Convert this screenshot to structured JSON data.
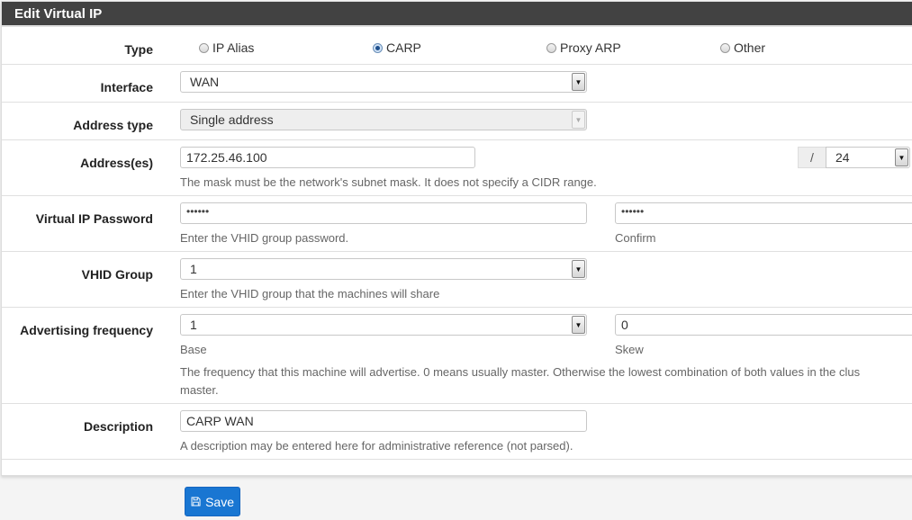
{
  "panel": {
    "title": "Edit Virtual IP"
  },
  "type": {
    "label": "Type",
    "options": [
      {
        "label": "IP Alias",
        "checked": false
      },
      {
        "label": "CARP",
        "checked": true
      },
      {
        "label": "Proxy ARP",
        "checked": false
      },
      {
        "label": "Other",
        "checked": false
      }
    ]
  },
  "interface": {
    "label": "Interface",
    "value": "WAN"
  },
  "address_type": {
    "label": "Address type",
    "value": "Single address",
    "disabled": true
  },
  "addresses": {
    "label": "Address(es)",
    "value": "172.25.46.100",
    "separator": "/",
    "mask": "24",
    "help": "The mask must be the network's subnet mask. It does not specify a CIDR range."
  },
  "password": {
    "label": "Virtual IP Password",
    "value": "••••••",
    "confirm_value": "••••••",
    "help": "Enter the VHID group password.",
    "confirm_help": "Confirm"
  },
  "vhid": {
    "label": "VHID Group",
    "value": "1",
    "help": "Enter the VHID group that the machines will share"
  },
  "advertising": {
    "label": "Advertising frequency",
    "base_value": "1",
    "skew_value": "0",
    "base_help": "Base",
    "skew_help": "Skew",
    "help_line1": "The frequency that this machine will advertise. 0 means usually master. Otherwise the lowest combination of both values in the clus",
    "help_line2": "master."
  },
  "description": {
    "label": "Description",
    "value": "CARP WAN",
    "help": "A description may be entered here for administrative reference (not parsed)."
  },
  "save_button": {
    "label": "Save",
    "icon": "floppy-disk-icon"
  },
  "colors": {
    "header_bg": "#424242",
    "primary": "#1976d2"
  }
}
